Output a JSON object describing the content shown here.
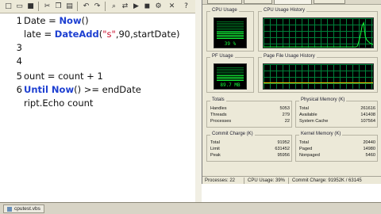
{
  "editor": {
    "lines": [
      {
        "num": "1",
        "text": "Date = Now()",
        "parts": [
          {
            "t": "Date = ",
            "c": ""
          },
          {
            "t": "Now",
            "c": "kw"
          },
          {
            "t": "()",
            "c": ""
          }
        ]
      },
      {
        "num": "",
        "text": "late = DateAdd(\"s\",90,startDate)",
        "parts": [
          {
            "t": "late = ",
            "c": ""
          },
          {
            "t": "DateAdd",
            "c": "kw"
          },
          {
            "t": "(",
            "c": ""
          },
          {
            "t": "\"s\"",
            "c": "st"
          },
          {
            "t": ",90,startDate)",
            "c": ""
          }
        ]
      },
      {
        "num": "3",
        "text": "",
        "parts": []
      },
      {
        "num": "4",
        "text": "",
        "parts": []
      },
      {
        "num": "5",
        "text": "ount = count + 1",
        "parts": [
          {
            "t": "ount = count + 1",
            "c": ""
          }
        ]
      },
      {
        "num": "6",
        "text": "Until Now() >= endDate",
        "parts": [
          {
            "t": "Until ",
            "c": "kw"
          },
          {
            "t": "Now",
            "c": "kw"
          },
          {
            "t": "() >= endDate",
            "c": ""
          }
        ]
      },
      {
        "num": "",
        "text": "ript.Echo count",
        "parts": [
          {
            "t": "ript",
            "c": ""
          },
          {
            "t": ".Echo count",
            "c": ""
          }
        ]
      }
    ],
    "file_tab": "cputest.vbs"
  },
  "task_manager": {
    "cpu_usage": {
      "title": "CPU Usage",
      "value": "39 %",
      "level": 0.39
    },
    "cpu_history": {
      "title": "CPU Usage History"
    },
    "pf_usage": {
      "title": "PF Usage",
      "value": "89.7 MB",
      "level": 0.35
    },
    "pf_history": {
      "title": "Page File Usage History"
    },
    "totals": {
      "title": "Totals",
      "rows": [
        {
          "k": "Handles",
          "v": "5053"
        },
        {
          "k": "Threads",
          "v": "279"
        },
        {
          "k": "Processes",
          "v": "22"
        }
      ]
    },
    "physical_memory": {
      "title": "Physical Memory (K)",
      "rows": [
        {
          "k": "Total",
          "v": "261616"
        },
        {
          "k": "Available",
          "v": "141408"
        },
        {
          "k": "System Cache",
          "v": "107564"
        }
      ]
    },
    "commit_charge": {
      "title": "Commit Charge (K)",
      "rows": [
        {
          "k": "Total",
          "v": "91952"
        },
        {
          "k": "Limit",
          "v": "631452"
        },
        {
          "k": "Peak",
          "v": "95956"
        }
      ]
    },
    "kernel_memory": {
      "title": "Kernel Memory (K)",
      "rows": [
        {
          "k": "Total",
          "v": "20440"
        },
        {
          "k": "Paged",
          "v": "14980"
        },
        {
          "k": "Nonpaged",
          "v": "5460"
        }
      ]
    },
    "status": {
      "processes": "Processes: 22",
      "cpu": "CPU Usage: 39%",
      "commit": "Commit Charge: 91952K / 63145"
    },
    "colors": {
      "graph_line": "#13ff3a",
      "grid": "#00823a",
      "background": "#000000"
    }
  }
}
